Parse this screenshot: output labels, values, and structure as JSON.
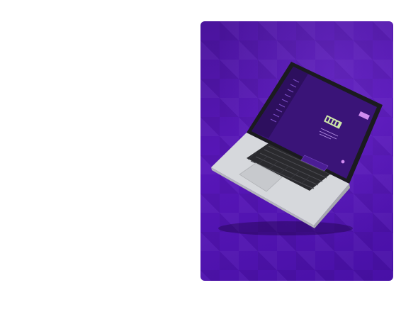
{
  "colors": {
    "card_bg": "#5214ad",
    "screen_bg": "#3a1478",
    "sidebar_bg": "#2d0f5e",
    "accent": "#d08cf0",
    "logo_green": "#cde6a8",
    "laptop_silver": "#c9cbcf"
  },
  "screen": {
    "logo_text": "SITEUP",
    "button_label": "",
    "input_placeholder": ""
  },
  "icons": {
    "card": "mockup-card",
    "laptop": "laptop-icon"
  }
}
